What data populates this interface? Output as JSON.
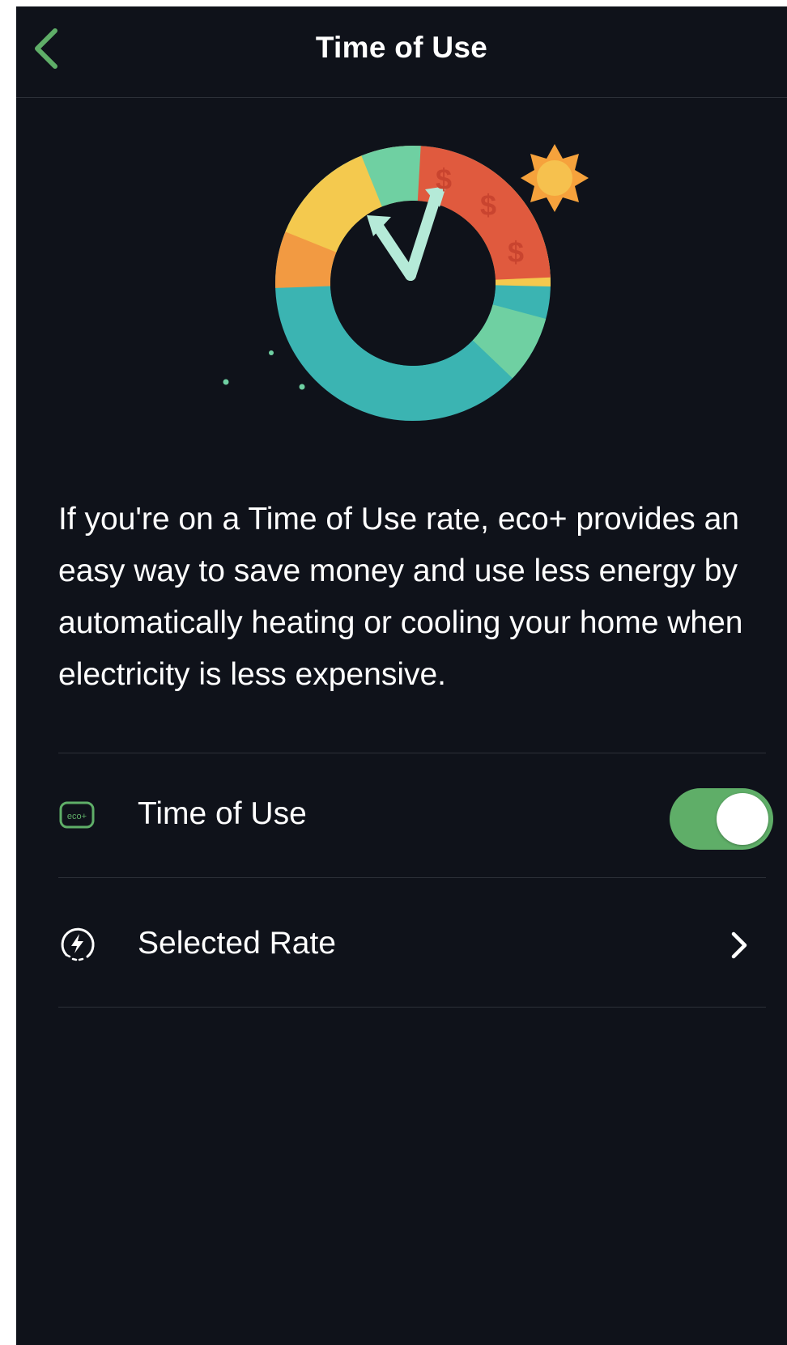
{
  "header": {
    "title": "Time of Use",
    "back_icon": "chevron-left-icon"
  },
  "illustration": {
    "icons": [
      "clock-icon",
      "sun-icon",
      "moon-icon",
      "dollar-icon"
    ],
    "dollar_symbol": "$",
    "colors": {
      "red": "#e05a3e",
      "orange": "#f29a42",
      "yellow": "#f4c94e",
      "mint": "#6fd0a2",
      "teal": "#3bb4b2",
      "hands": "#b5ead8"
    }
  },
  "description": "If you're on a Time of Use rate, eco+ provides an easy way to save money and use less energy by automatically heating or cooling your home when electricity is less expensive.",
  "settings": {
    "time_of_use": {
      "label": "Time of Use",
      "icon": "eco-plus-icon",
      "icon_text": "eco+",
      "enabled": true
    },
    "selected_rate": {
      "label": "Selected Rate",
      "icon": "rate-bolt-icon"
    }
  },
  "colors": {
    "background": "#0f121a",
    "accent": "#5fae68",
    "divider": "#2c3038",
    "text": "#ffffff"
  }
}
